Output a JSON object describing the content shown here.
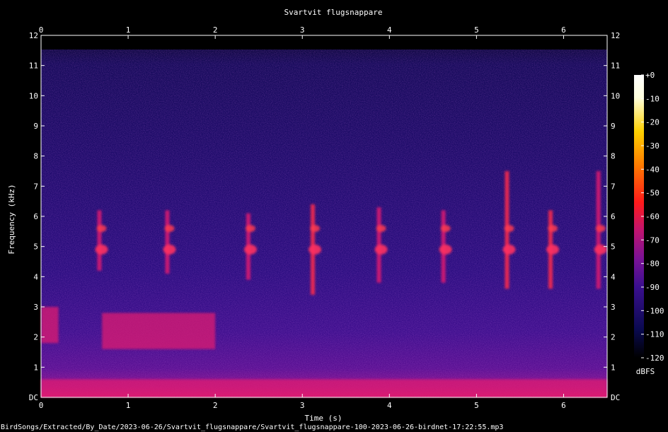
{
  "chart_data": {
    "type": "heatmap",
    "title": "Svartvit flugsnappare",
    "xlabel": "Time (s)",
    "ylabel": "Frequency (kHz)",
    "xlim": [
      0,
      6.5
    ],
    "ylim": [
      0,
      12
    ],
    "x_ticks": [
      "0",
      "1",
      "2",
      "3",
      "4",
      "5",
      "6"
    ],
    "y_ticks": [
      "DC",
      "1",
      "2",
      "3",
      "4",
      "5",
      "6",
      "7",
      "8",
      "9",
      "10",
      "11",
      "12"
    ],
    "colorbar": {
      "unit": "dBFS",
      "range": [
        -120,
        0
      ],
      "ticks": [
        "+0",
        "-10",
        "-20",
        "-30",
        "-40",
        "-50",
        "-60",
        "-70",
        "-80",
        "-90",
        "-100",
        "-110",
        "-120"
      ],
      "colors": [
        "#000000",
        "#0a0a50",
        "#3a0f8f",
        "#7a1296",
        "#c01470",
        "#ff1a1a",
        "#ff7a00",
        "#ffd000",
        "#ffffdd",
        "#ffffff"
      ]
    },
    "calls": [
      {
        "t": 0.67,
        "freq_khz": [
          4.2,
          6.2
        ],
        "intensity_dbfs": -55
      },
      {
        "t": 1.45,
        "freq_khz": [
          4.1,
          6.2
        ],
        "intensity_dbfs": -55
      },
      {
        "t": 2.38,
        "freq_khz": [
          3.9,
          6.1
        ],
        "intensity_dbfs": -55
      },
      {
        "t": 3.12,
        "freq_khz": [
          3.4,
          6.4
        ],
        "intensity_dbfs": -50
      },
      {
        "t": 3.88,
        "freq_khz": [
          3.8,
          6.3
        ],
        "intensity_dbfs": -55
      },
      {
        "t": 4.62,
        "freq_khz": [
          3.8,
          6.2
        ],
        "intensity_dbfs": -55
      },
      {
        "t": 5.35,
        "freq_khz": [
          3.6,
          7.5
        ],
        "intensity_dbfs": -50
      },
      {
        "t": 5.85,
        "freq_khz": [
          3.6,
          6.2
        ],
        "intensity_dbfs": -50
      },
      {
        "t": 6.4,
        "freq_khz": [
          3.6,
          7.5
        ],
        "intensity_dbfs": -55
      }
    ],
    "background_bands": [
      {
        "t_start": 0.0,
        "t_end": 0.2,
        "freq_khz": [
          1.8,
          3.0
        ],
        "intensity_dbfs": -60
      },
      {
        "t_start": 0.7,
        "t_end": 2.0,
        "freq_khz": [
          1.6,
          2.8
        ],
        "intensity_dbfs": -60
      },
      {
        "t_start": 0.0,
        "t_end": 6.5,
        "freq_khz": [
          0.0,
          0.6
        ],
        "intensity_dbfs": -65
      }
    ]
  },
  "footer": {
    "file_path": "BirdSongs/Extracted/By_Date/2023-06-26/Svartvit_flugsnappare/Svartvit_flugsnappare-100-2023-06-26-birdnet-17:22:55.mp3"
  }
}
